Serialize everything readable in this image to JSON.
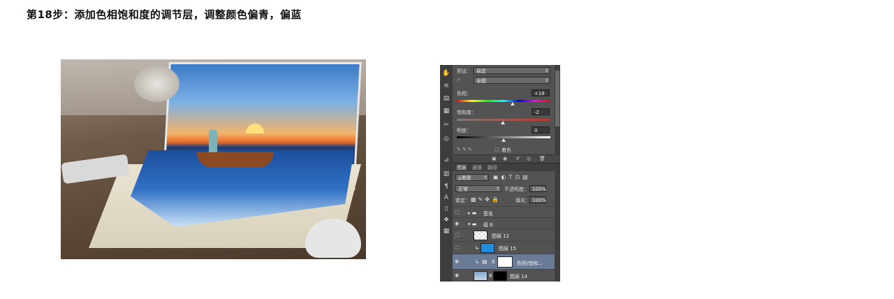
{
  "step_title": "第18步：添加色相饱和度的调节层，调整颜色偏青，偏蓝",
  "properties": {
    "preset_label": "预设：",
    "preset_value": "自定",
    "channel_value": "全图",
    "hue_label": "色相：",
    "hue_value": "+18",
    "saturation_label": "饱和度：",
    "saturation_value": "-2",
    "lightness_label": "明度：",
    "lightness_value": "0",
    "colorize_label": "着色"
  },
  "layers_panel": {
    "tabs": [
      "图层",
      "通道",
      "路径"
    ],
    "filter_value": "ρ类型",
    "blend_mode": "正常",
    "opacity_label": "不透明度：",
    "opacity_value": "100%",
    "lock_label": "锁定：",
    "fill_label": "填充：",
    "fill_value": "100%",
    "layers": [
      {
        "name": "签名",
        "type": "group",
        "visible": false
      },
      {
        "name": "组 6",
        "type": "group",
        "visible": true
      },
      {
        "name": "图层 12",
        "type": "layer",
        "visible": false
      },
      {
        "name": "图层 15",
        "type": "layer",
        "visible": false
      },
      {
        "name": "色相/饱和...",
        "type": "adjustment",
        "visible": true,
        "selected": true
      },
      {
        "name": "图层 14",
        "type": "layer",
        "visible": true
      }
    ]
  },
  "colors": {
    "panel_bg": "#535353",
    "selected_layer": "#6a7c95",
    "layer15_thumb": "#1e8de0"
  }
}
